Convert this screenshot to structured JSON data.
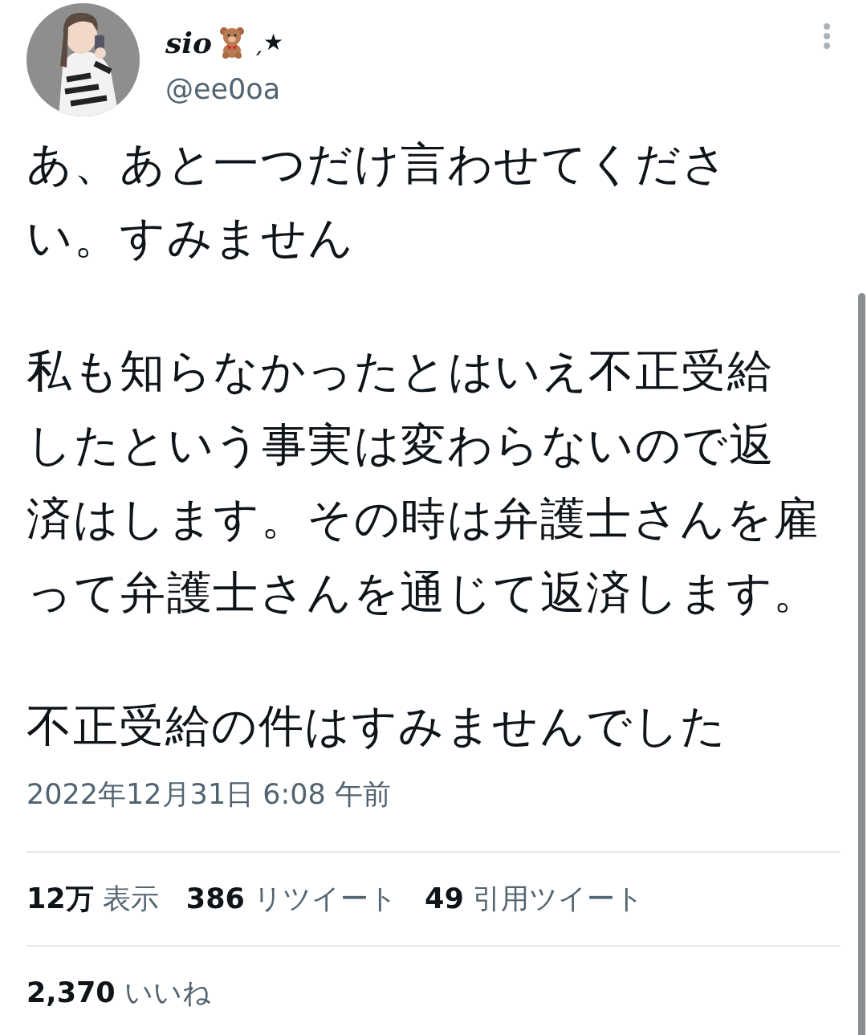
{
  "author": {
    "display_name": "sio",
    "name_suffix": "ˏ★",
    "handle": "@ee0oa"
  },
  "tweet": {
    "paragraphs": [
      [
        "あ、あと一つだけ言わせてくださ",
        "い。すみません"
      ],
      [
        "私も知らなかったとはいえ不正受給",
        "したという事実は変わらないので返",
        "済はします。その時は弁護士さんを雇",
        "って弁護士さんを通じて返済します。"
      ],
      [
        "不正受給の件はすみませんでした"
      ]
    ],
    "timestamp": "2022年12月31日 6:08 午前"
  },
  "stats": [
    [
      {
        "count": "12万",
        "label": "表示"
      },
      {
        "count": "386",
        "label": "リツイート"
      },
      {
        "count": "49",
        "label": "引用ツイート"
      }
    ],
    [
      {
        "count": "2,370",
        "label": "いいね"
      }
    ]
  ]
}
